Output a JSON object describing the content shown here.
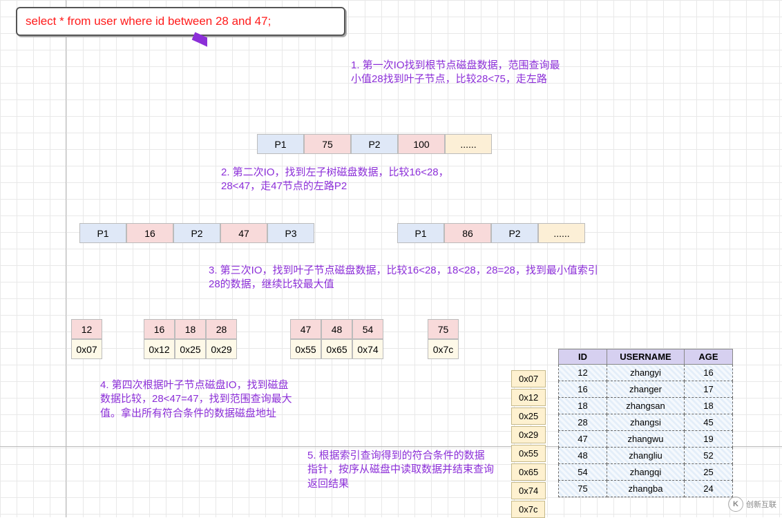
{
  "sql": "select * from user where id between 28 and 47;",
  "steps": {
    "s1": "1. 第一次IO找到根节点磁盘数据，范围查询最小值28找到叶子节点，比较28<75，走左路",
    "s2": "2. 第二次IO，找到左子树磁盘数据，比较16<28，28<47，走47节点的左路P2",
    "s3": "3. 第三次IO，找到叶子节点磁盘数据，比较16<28，18<28，28=28，找到最小值索引28的数据，继续比较最大值",
    "s4": "4. 第四次根据叶子节点磁盘IO，找到磁盘数据比较，28<47=47，找到范围查询最大值。拿出所有符合条件的数据磁盘地址",
    "s5": "5. 根据索引查询得到的符合条件的数据指针，按序从磁盘中读取数据并结束查询返回结果"
  },
  "root": [
    "P1",
    "75",
    "P2",
    "100",
    "......"
  ],
  "l2a": [
    "P1",
    "16",
    "P2",
    "47",
    "P3"
  ],
  "l2b": [
    "P1",
    "86",
    "P2",
    "......"
  ],
  "leaf1": {
    "k": [
      "12"
    ],
    "a": [
      "0x07"
    ]
  },
  "leaf2": {
    "k": [
      "16",
      "18",
      "28"
    ],
    "a": [
      "0x12",
      "0x25",
      "0x29"
    ]
  },
  "leaf3": {
    "k": [
      "47",
      "48",
      "54"
    ],
    "a": [
      "0x55",
      "0x65",
      "0x74"
    ]
  },
  "leaf4": {
    "k": [
      "75"
    ],
    "a": [
      "0x7c"
    ]
  },
  "ptrs": [
    "0x07",
    "0x12",
    "0x25",
    "0x29",
    "0x55",
    "0x65",
    "0x74",
    "0x7c"
  ],
  "thead": [
    "ID",
    "USERNAME",
    "AGE"
  ],
  "rows": [
    [
      "12",
      "zhangyi",
      "16"
    ],
    [
      "16",
      "zhanger",
      "17"
    ],
    [
      "18",
      "zhangsan",
      "18"
    ],
    [
      "28",
      "zhangsi",
      "45"
    ],
    [
      "47",
      "zhangwu",
      "19"
    ],
    [
      "48",
      "zhangliu",
      "52"
    ],
    [
      "54",
      "zhangqi",
      "25"
    ],
    [
      "75",
      "zhangba",
      "24"
    ]
  ],
  "logo": "创新互联"
}
